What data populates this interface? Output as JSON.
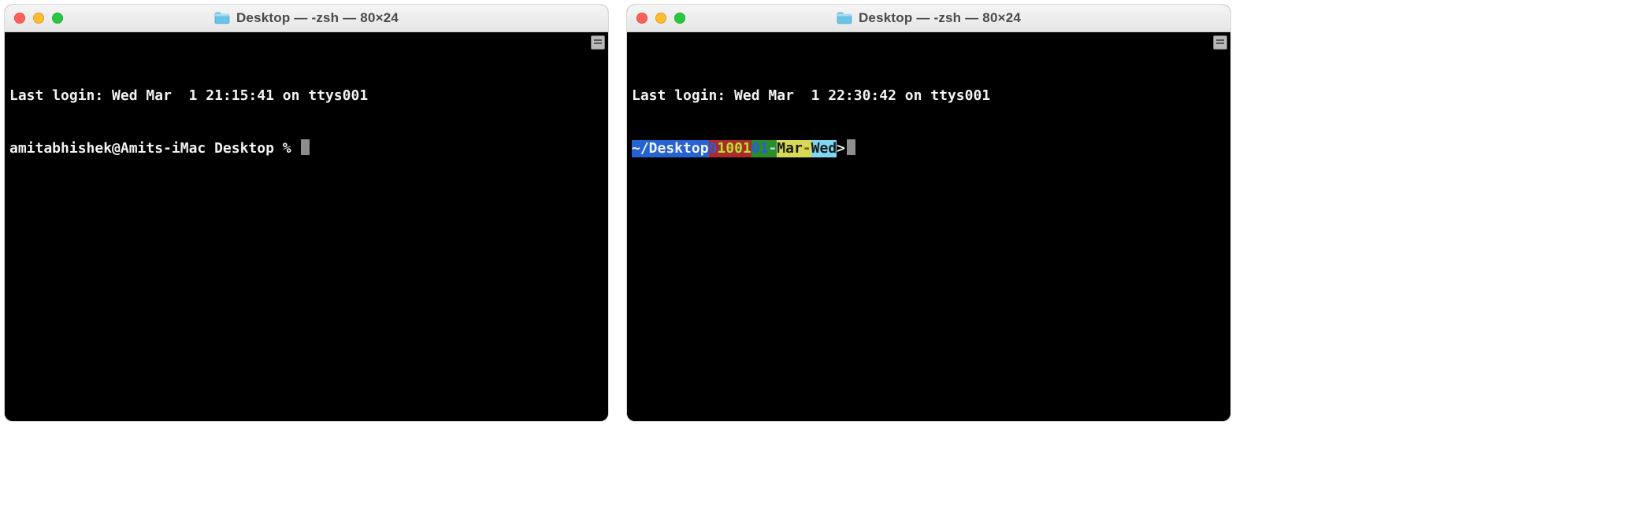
{
  "left": {
    "title": "Desktop — -zsh — 80×24",
    "last_login": "Last login: Wed Mar  1 21:15:41 on ttys001",
    "prompt": "amitabhishek@Amits-iMac Desktop % "
  },
  "right": {
    "title": "Desktop — -zsh — 80×24",
    "last_login": "Last login: Wed Mar  1 22:30:42 on ttys001",
    "prompt_segments": {
      "path": "~/Desktop",
      "digit0": "0",
      "digits_rest": "1001",
      "date_num": "01",
      "dash1": "-",
      "month": "Mar",
      "dash2": "-",
      "weekday": "Wed",
      "gt": ">"
    }
  }
}
